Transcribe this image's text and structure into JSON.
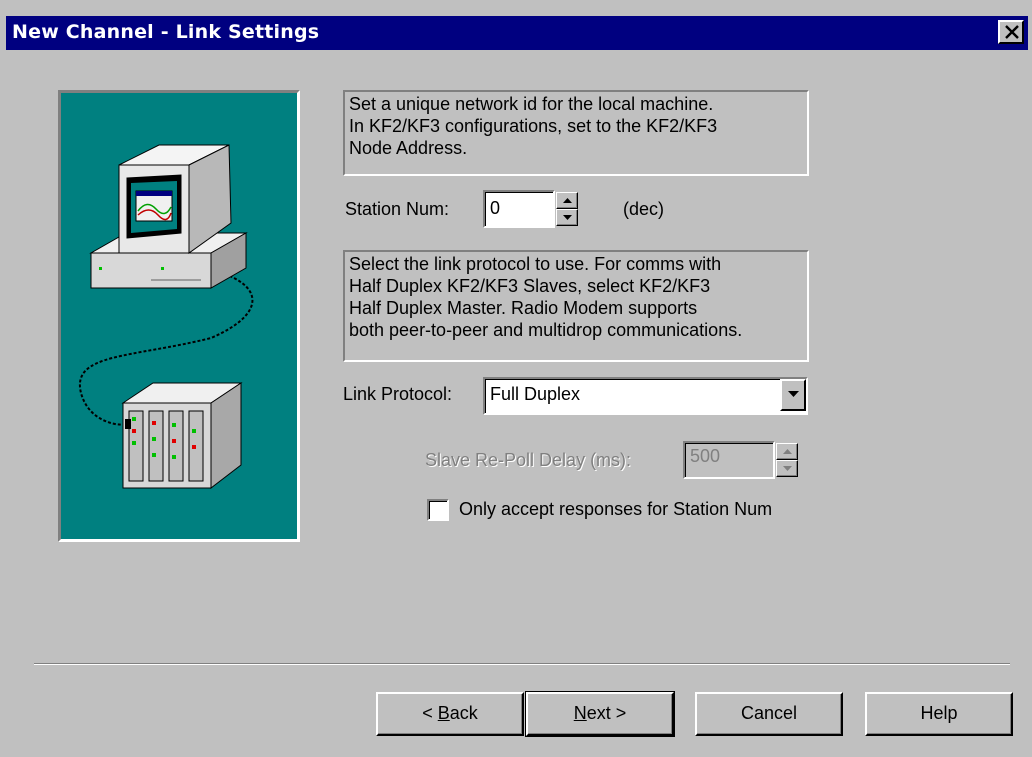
{
  "window": {
    "title": "New Channel - Link Settings",
    "close_icon": "close-icon"
  },
  "info_station": "Set a unique network id for the local machine.\nIn KF2/KF3 configurations, set to the KF2/KF3\nNode Address.",
  "station_num": {
    "label": "Station Num:",
    "value": "0",
    "unit": "(dec)"
  },
  "info_protocol": "Select the link protocol to use.  For comms with\nHalf Duplex KF2/KF3 Slaves, select KF2/KF3\nHalf Duplex Master.  Radio Modem supports\nboth peer-to-peer and multidrop communications.",
  "link_protocol": {
    "label": "Link Protocol:",
    "selected": "Full Duplex"
  },
  "repoll": {
    "label": "Slave Re-Poll Delay (ms):",
    "value": "500",
    "enabled": false
  },
  "only_accept": {
    "label": "Only accept responses for Station Num",
    "checked": false
  },
  "buttons": {
    "back": {
      "prefix": "< ",
      "mnemonic": "B",
      "rest": "ack"
    },
    "next": {
      "mnemonic": "N",
      "rest": "ext >"
    },
    "cancel": "Cancel",
    "help": "Help"
  },
  "colors": {
    "titlebar": "#000080",
    "face": "#c0c0c0",
    "illustration_bg": "#008080"
  }
}
